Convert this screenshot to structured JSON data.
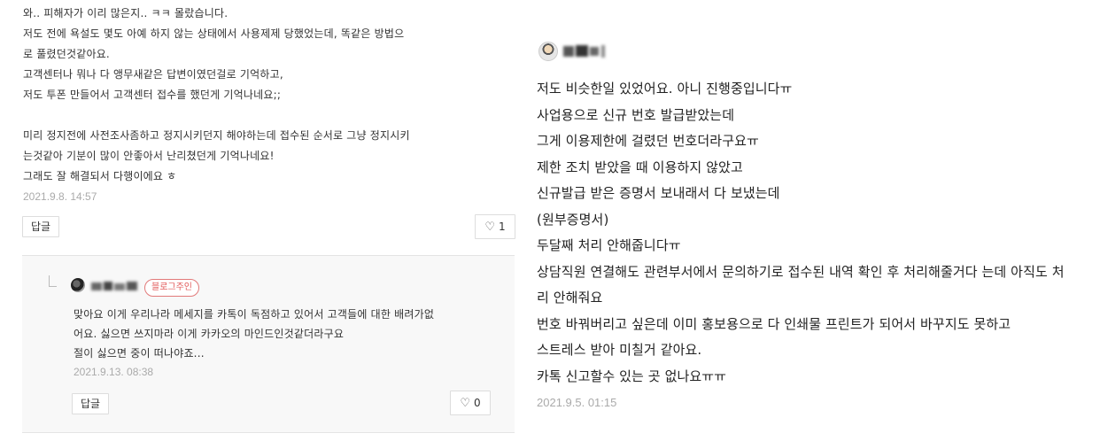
{
  "left_comment": {
    "lines": [
      "와.. 피해자가 이리 많은지.. ㅋㅋ 몰랐습니다.",
      "저도 전에 욕설도 몇도 아예 하지 않는 상태에서 사용제제 당했었는데, 똑같은 방법으",
      "로 풀렸던것같아요.",
      "고객센터나 뭐나 다 앵무새같은 답변이였던걸로 기억하고,",
      "저도 투폰 만들어서 고객센터 접수를 했던게 기억나네요;;",
      "",
      "미리 정지전에 사전조사좀하고 정지시키던지 해야하는데 접수된 순서로 그냥 정지시키",
      "는것같아 기분이 많이 안좋아서 난리쳤던게 기억나네요!",
      "그래도 잘 해결되서 다행이에요 ㅎ"
    ],
    "date": "2021.9.8. 14:57",
    "reply_label": "답글",
    "like_count": "1"
  },
  "left_reply": {
    "badge": "블로그주인",
    "lines": [
      "맞아요 이게 우리나라 메세지를 카톡이 독점하고 있어서 고객들에 대한 배려가없",
      "어요. 싫으면 쓰지마라 이게 카카오의 마인드인것같더라구요",
      "절이 싫으면 중이 떠나야죠..."
    ],
    "date": "2021.9.13. 08:38",
    "reply_label": "답글",
    "like_count": "0"
  },
  "right_comment": {
    "lines": [
      "저도 비슷한일 있었어요. 아니 진행중입니다ㅠ",
      "사업용으로 신규 번호 발급받았는데",
      "그게 이용제한에 걸렸던 번호더라구요ㅠ",
      "제한 조치 받았을 때 이용하지 않았고",
      "신규발급 받은 증명서 보내래서 다 보냈는데",
      "(원부증명서)",
      "두달째 처리 안해줍니다ㅠ",
      "상담직원 연결해도 관련부서에서 문의하기로 접수된 내역 확인 후 처리해줄거다 는데 아직도 처",
      "리 안해줘요",
      "번호 바꿔버리고 싶은데 이미 홍보용으로 다 인쇄물 프린트가 되어서 바꾸지도 못하고",
      "스트레스 받아 미칠거 같아요.",
      "카톡 신고할수 있는 곳 없나요ㅠㅠ"
    ],
    "date": "2021.9.5. 01:15"
  },
  "icons": {
    "heart": "♡"
  }
}
